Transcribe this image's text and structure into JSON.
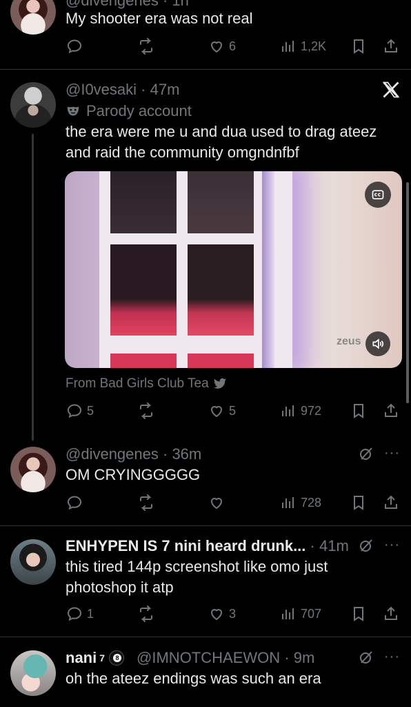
{
  "tweet_top": {
    "username_partial": "@divengenes · 1h",
    "text": "My shooter era was not real",
    "likes": "6",
    "views": "1,2K"
  },
  "tweet_main": {
    "handle": "@I0vesaki",
    "time": "47m",
    "badge": "Parody account",
    "text_line1": "the era were me u and dua used to drag ateez",
    "text_line2": "and raid the community omgndnfbf",
    "video_watermark": "zeus",
    "source": "From Bad Girls Club Tea",
    "replies": "5",
    "likes": "5",
    "views": "972"
  },
  "reply1": {
    "handle": "@divengenes",
    "time": "36m",
    "text": "OM CRYINGGGGG",
    "views": "728"
  },
  "reply2": {
    "name": "ENHYPEN IS 7 nini heard drunk...",
    "time": "41m",
    "text_line1": "this tired 144p screenshot like omo just",
    "text_line2": "photoshop it atp",
    "replies": "1",
    "likes": "3",
    "views": "707"
  },
  "reply3": {
    "name": "nani",
    "superscript": "7",
    "handle": "@IMNOTCHAEWON",
    "time": "9m",
    "text": "oh the ateez endings was such an era"
  },
  "colors": {
    "background": "#000000",
    "text": "#e7e9ea",
    "muted": "#71767b",
    "divider": "#2f3336"
  }
}
